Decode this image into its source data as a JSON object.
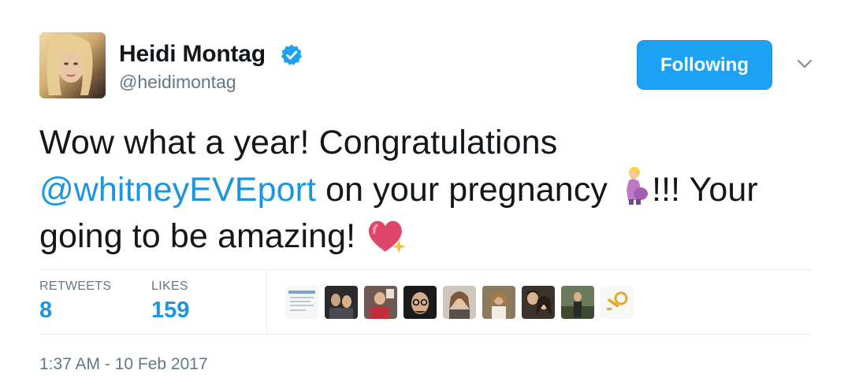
{
  "user": {
    "display_name": "Heidi Montag",
    "handle": "@heidimontag",
    "verified_icon": "verified-badge-icon"
  },
  "actions": {
    "follow_label": "Following",
    "caret_icon": "chevron-down-icon"
  },
  "tweet": {
    "line1": "Wow what a year! Congratulations",
    "mention": "@whitneyEVEport",
    "line2_after_mention": " on your pregnancy ",
    "line2_end": "!!! Your",
    "line3": "going to be amazing! ",
    "emojis": [
      "pregnant-woman-emoji",
      "sparkling-heart-emoji"
    ]
  },
  "stats": {
    "retweets_label": "RETWEETS",
    "retweets_value": "8",
    "likes_label": "LIKES",
    "likes_value": "159"
  },
  "likers": [
    "liker-1",
    "liker-2",
    "liker-3",
    "liker-4",
    "liker-5",
    "liker-6",
    "liker-7",
    "liker-8",
    "liker-9"
  ],
  "timestamp": "1:37 AM - 10 Feb 2017",
  "colors": {
    "accent": "#1da1f2",
    "link": "#1b95e0",
    "text": "#14171a",
    "muted": "#657786"
  }
}
